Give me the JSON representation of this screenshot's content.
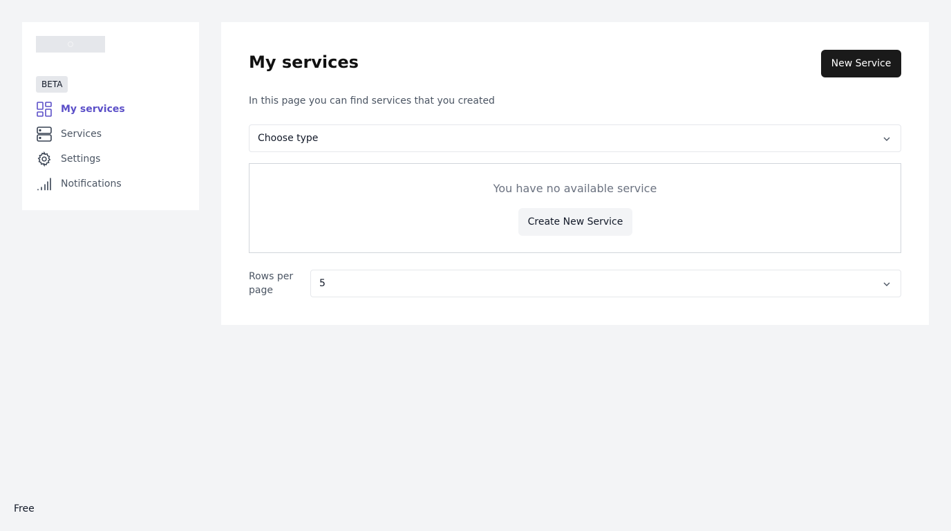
{
  "sidebar": {
    "badge": "BETA",
    "items": [
      {
        "label": "My services",
        "icon": "grid-icon",
        "active": true
      },
      {
        "label": "Services",
        "icon": "server-icon",
        "active": false
      },
      {
        "label": "Settings",
        "icon": "gear-icon",
        "active": false
      },
      {
        "label": "Notifications",
        "icon": "signal-bars-icon",
        "active": false
      }
    ]
  },
  "main": {
    "title": "My services",
    "new_button": "New Service",
    "subtitle": "In this page you can find services that you created",
    "type_select": {
      "value": "Choose type"
    },
    "empty_state": {
      "message": "You have no available service",
      "button": "Create New Service"
    },
    "rows_per_page": {
      "label": "Rows per page",
      "value": "5"
    }
  },
  "footer": {
    "plan": "Free"
  },
  "colors": {
    "accent": "#5b4fc8",
    "primary_button": "#1a1a1a",
    "background": "#f3f4f6"
  }
}
